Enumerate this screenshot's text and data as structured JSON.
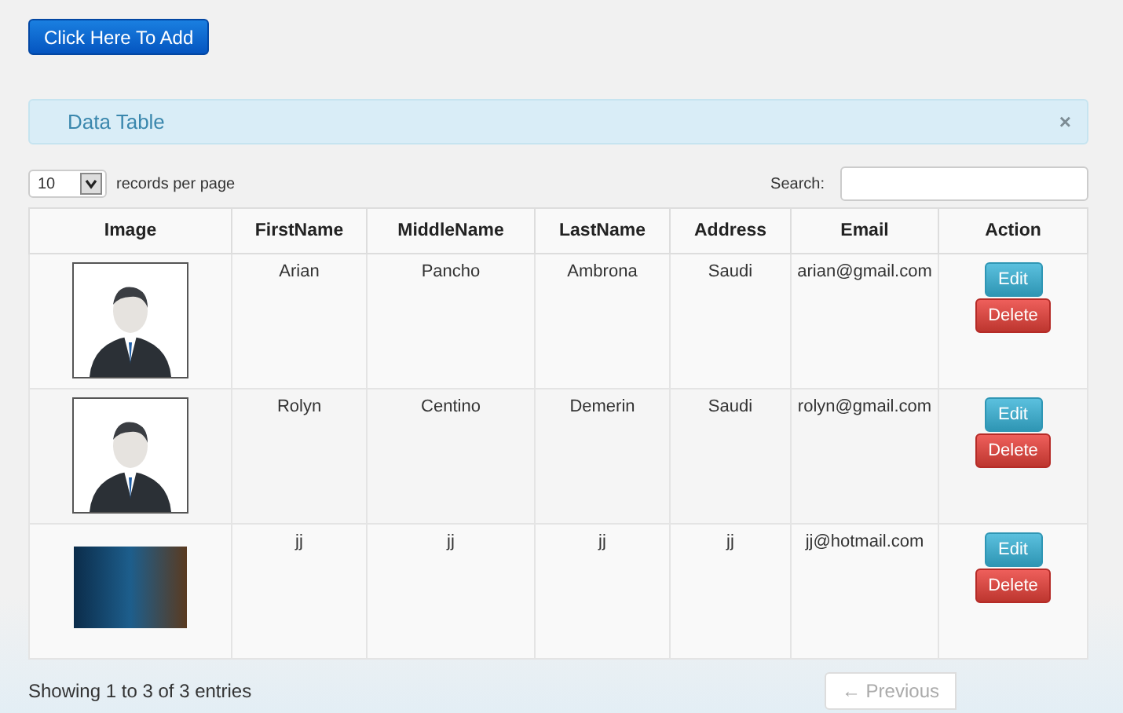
{
  "add_button": {
    "label": "Click Here To Add"
  },
  "panel": {
    "title": "Data Table",
    "close": "×"
  },
  "length": {
    "value": "10",
    "label": "records per page"
  },
  "search": {
    "label": "Search:"
  },
  "table": {
    "columns": [
      "Image",
      "FirstName",
      "MiddleName",
      "LastName",
      "Address",
      "Email",
      "Action"
    ],
    "rows": [
      {
        "kind": "avatar",
        "cells": [
          "",
          "Arian",
          "Pancho",
          "Ambrona",
          "Saudi",
          "arian@gmail.com"
        ],
        "actions": [
          "Edit",
          "Delete"
        ]
      },
      {
        "kind": "avatar",
        "cells": [
          "",
          "Rolyn",
          "Centino",
          "Demerin",
          "Saudi",
          "rolyn@gmail.com"
        ],
        "actions": [
          "Edit",
          "Delete"
        ]
      },
      {
        "kind": "photo",
        "cells": [
          "",
          "jj",
          "jj",
          "jj",
          "jj",
          "jj@hotmail.com"
        ],
        "actions": [
          "Edit",
          "Delete"
        ]
      }
    ]
  },
  "info": "Showing 1 to 3 of 3 entries",
  "pagination": {
    "previous": {
      "label": "← Previous",
      "disabled": true
    }
  }
}
